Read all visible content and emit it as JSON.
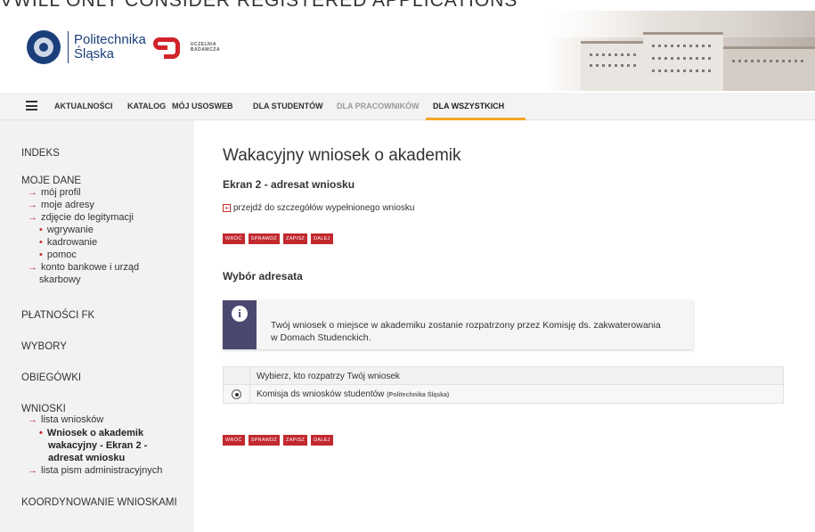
{
  "top_banner": "VWILL ONLY CONSIDER REGISTERED APPLICATIONS",
  "logo": {
    "line1": "Politechnika",
    "line2": "Śląska",
    "tag1": "UCZELNIA",
    "tag2": "BADAWCZA"
  },
  "nav": {
    "items": [
      "AKTUALNOŚCI",
      "KATALOG",
      "MÓJ USOSWEB",
      "DLA STUDENTÓW",
      "DLA PRACOWNIKÓW",
      "DLA WSZYSTKICH"
    ],
    "active": "DLA WSZYSTKICH",
    "accent": "#f5a623"
  },
  "sidebar": {
    "indeks": "INDEKS",
    "moje_dane": "MOJE DANE",
    "moj_profil": "mój profil",
    "moje_adresy": "moje adresy",
    "zdjecie": "zdjęcie do legitymacji",
    "wgrywanie": "wgrywanie",
    "kadrowanie": "kadrowanie",
    "pomoc": "pomoc",
    "konto1": "konto bankowe i urząd",
    "konto2": "skarbowy",
    "platnosci": "PŁATNOŚCI FK",
    "wybory": "WYBORY",
    "obiegowki": "OBIEGÓWKI",
    "wnioski": "WNIOSKI",
    "lista_wnioskow": "lista wniosków",
    "current1": "Wniosek o akademik",
    "current2": "wakacyjny - Ekran 2 -",
    "current3": "adresat wniosku",
    "lista_pism": "lista pism administracyjnych",
    "koordynowanie": "KOORDYNOWANIE WNIOSKAMI"
  },
  "main": {
    "title": "Wakacyjny wniosek o akademik",
    "subtitle": "Ekran 2 - adresat wniosku",
    "details_link": "przejdź do szczegółów wypełnionego wniosku",
    "buttons": {
      "back": "WRÓĆ",
      "check": "SPRAWDŹ",
      "save": "ZAPISZ",
      "next": "DALEJ"
    },
    "section_title": "Wybór adresata",
    "info_text": "Twój wniosek o miejsce w akademiku zostanie rozpatrzony przez Komisję ds. zakwaterowania w Domach Studenckich.",
    "table_header": "Wybierz, kto rozpatrzy Twój wniosek",
    "option_label": "Komisja ds wniosków studentów",
    "option_sub": "(Politechnika Śląska)"
  },
  "colors": {
    "brand_red": "#c2292e",
    "info_purple": "#4b4870",
    "navy": "#1b3f7a"
  }
}
